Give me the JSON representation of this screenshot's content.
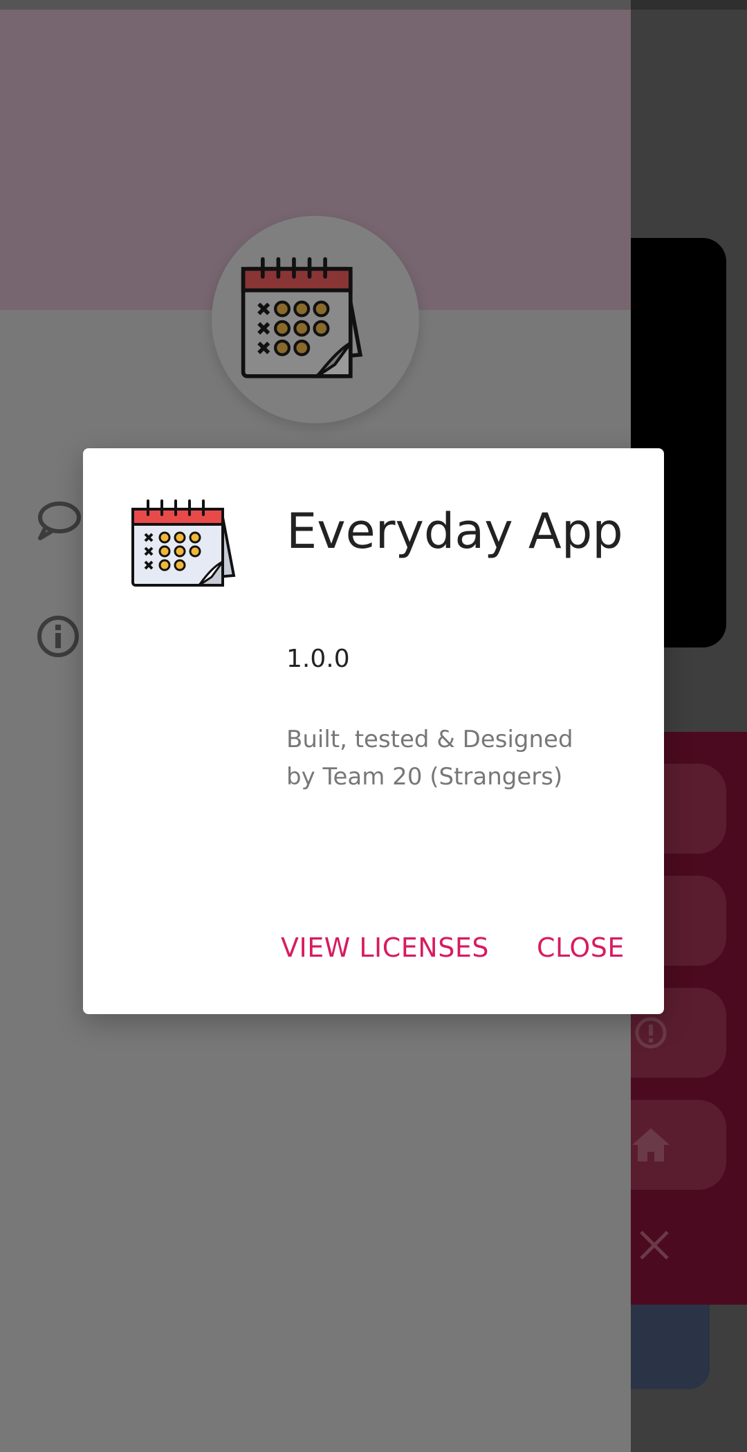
{
  "dialog": {
    "app_name": "Everyday App",
    "version": "1.0.0",
    "legalese": "Built, tested & Designed by Team 20 (Strangers)",
    "view_licenses_label": "VIEW LICENSES",
    "close_label": "CLOSE",
    "accent_color": "#d81b60"
  },
  "drawer": {
    "items": [
      {
        "icon": "chat-bubble-icon"
      },
      {
        "icon": "info-icon"
      }
    ]
  },
  "background_app": {
    "buttons": [
      {
        "icon": "notification-icon"
      },
      {
        "icon": "shield-icon"
      },
      {
        "icon": "alert-icon"
      },
      {
        "icon": "home-icon"
      }
    ],
    "close_icon": "close-icon"
  }
}
